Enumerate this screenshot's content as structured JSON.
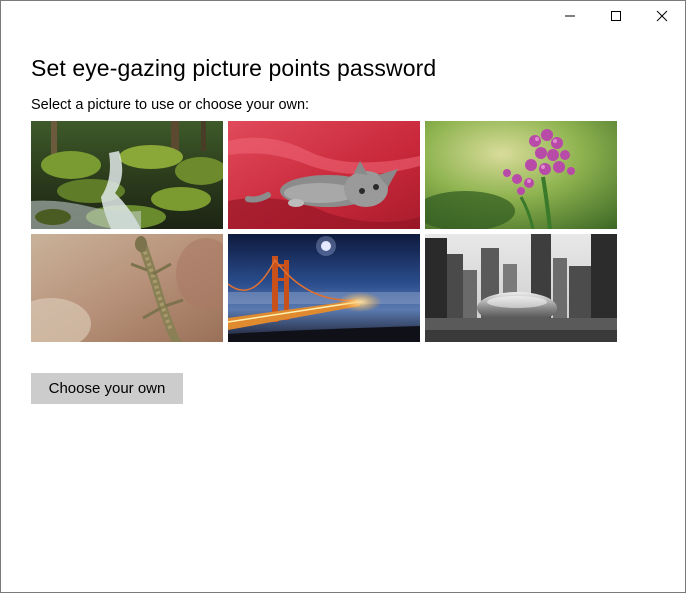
{
  "window": {
    "controls": {
      "minimize_icon": "minimize-icon",
      "maximize_icon": "maximize-icon",
      "close_icon": "close-icon"
    }
  },
  "main": {
    "title": "Set eye-gazing picture points password",
    "subtitle": "Select a picture to use or choose your own:",
    "pictures": [
      {
        "subject": "mossy-waterfall"
      },
      {
        "subject": "kitten-on-red-fabric"
      },
      {
        "subject": "purple-flower"
      },
      {
        "subject": "lizard-on-rock"
      },
      {
        "subject": "golden-gate-bridge-night"
      },
      {
        "subject": "cloud-gate-chicago-bw"
      }
    ],
    "choose_button_label": "Choose your own"
  },
  "colors": {
    "button_bg": "#cccccc",
    "window_border": "#7a7a7a"
  }
}
